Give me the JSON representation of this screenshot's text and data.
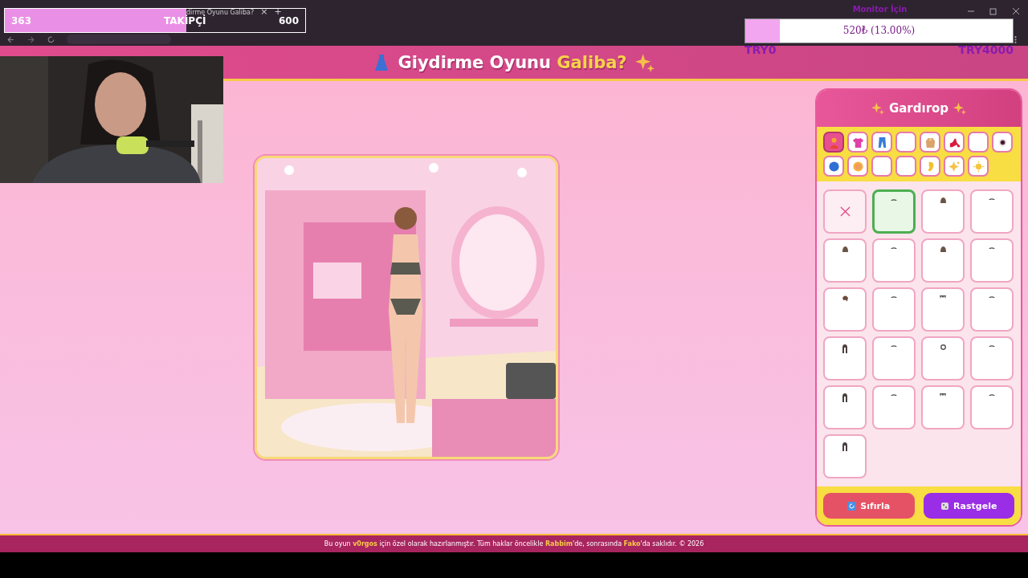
{
  "browser": {
    "tab_title": "dirme Oyunu Galiba?",
    "tab_close": "×",
    "new_tab": "+"
  },
  "follower_goal": {
    "count": "363",
    "label": "TAKİPÇİ",
    "goal": "600",
    "level": 0.605
  },
  "donation_goal": {
    "title": "Monitor İçin",
    "amount": "520₺ (13.00%)",
    "level": 0.13,
    "min": "TRY0",
    "max": "TRY4000"
  },
  "header": {
    "title": "Giydirme Oyunu",
    "title_accent": "Galiba?"
  },
  "wardrobe": {
    "title": "Gardırop",
    "categories": [
      {
        "kind": "person",
        "selected": true
      },
      {
        "kind": "shirt",
        "selected": false
      },
      {
        "kind": "pants",
        "selected": false
      },
      {
        "kind": "blank",
        "selected": false
      },
      {
        "kind": "coat",
        "selected": false
      },
      {
        "kind": "heel",
        "selected": false
      },
      {
        "kind": "blank",
        "selected": false
      },
      {
        "kind": "eye",
        "selected": false
      },
      {
        "kind": "ball",
        "selected": false
      },
      {
        "kind": "face",
        "selected": false
      },
      {
        "kind": "blank",
        "selected": false
      },
      {
        "kind": "blank",
        "selected": false
      },
      {
        "kind": "ear",
        "selected": false
      },
      {
        "kind": "sparkle",
        "selected": false
      },
      {
        "kind": "sun",
        "selected": false
      }
    ],
    "items": [
      {
        "kind": "none",
        "selected": false
      },
      {
        "kind": "arc",
        "selected": true
      },
      {
        "kind": "bun",
        "selected": false
      },
      {
        "kind": "arc",
        "selected": false
      },
      {
        "kind": "bun",
        "selected": false
      },
      {
        "kind": "arc",
        "selected": false
      },
      {
        "kind": "bun",
        "selected": false
      },
      {
        "kind": "arc",
        "selected": false
      },
      {
        "kind": "side",
        "selected": false
      },
      {
        "kind": "arc",
        "selected": false
      },
      {
        "kind": "bangs",
        "selected": false
      },
      {
        "kind": "arc",
        "selected": false
      },
      {
        "kind": "long",
        "selected": false
      },
      {
        "kind": "arc",
        "selected": false
      },
      {
        "kind": "ring",
        "selected": false
      },
      {
        "kind": "arc",
        "selected": false
      },
      {
        "kind": "long",
        "selected": false
      },
      {
        "kind": "arc",
        "selected": false
      },
      {
        "kind": "bangs",
        "selected": false
      },
      {
        "kind": "arc",
        "selected": false
      },
      {
        "kind": "long",
        "selected": false
      }
    ],
    "reset_button": "Sıfırla",
    "random_button": "Rastgele"
  },
  "footer": "Bu oyun **v0rgos** için özel olarak hazırlanmıştır. Tüm haklar öncelikle **Rabbim**'de, sonrasında **Fako**'da saklıdır. © 2026"
}
